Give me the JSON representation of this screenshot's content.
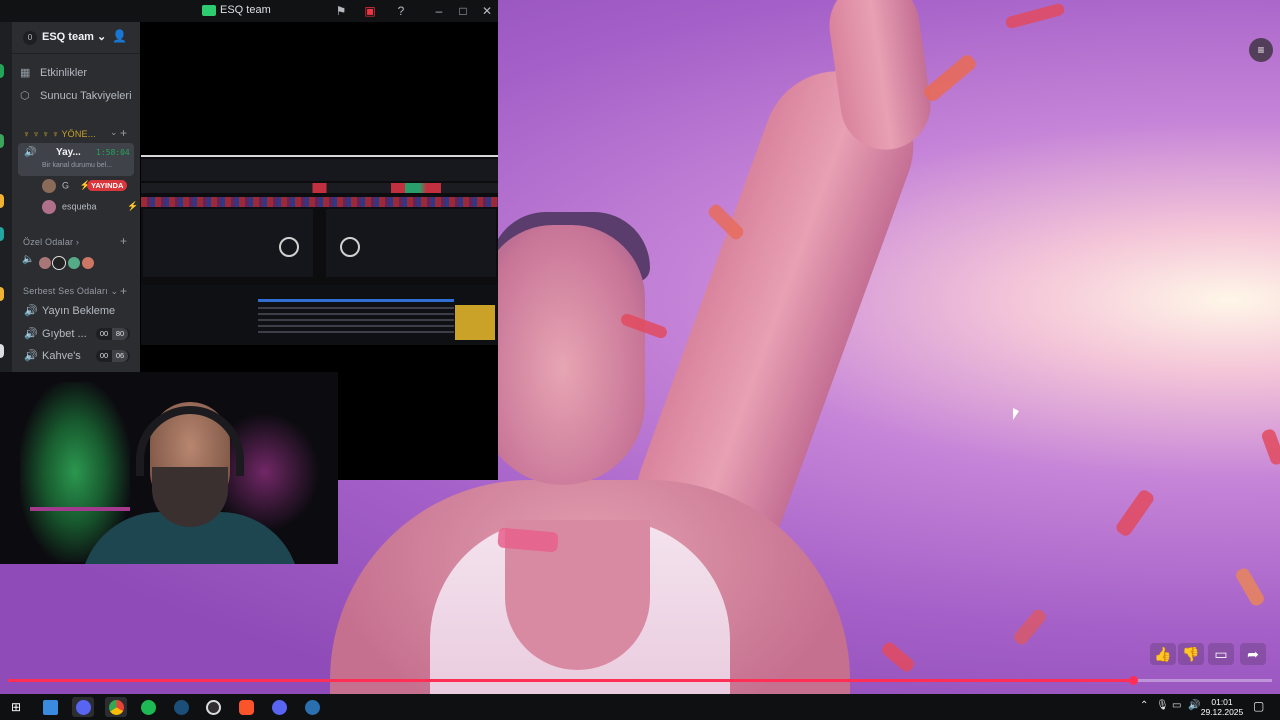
{
  "window": {
    "title": "ESQ team"
  },
  "server": {
    "badge": "0",
    "name": "ESQ team ⌄"
  },
  "nav": [
    {
      "icon": "calendar-icon",
      "label": "Etkinlikler"
    },
    {
      "icon": "boost-icon",
      "label": "Sunucu Takviyeleri"
    }
  ],
  "categories": {
    "admin": "♆ ♆ ♆ ♆ YÖNE...",
    "private": "Özel Odalar ›",
    "free": "Serbest Ses Odaları ⌄"
  },
  "active_voice": {
    "name": "Yay...",
    "timer": "1:58:04",
    "status": "Bir kanal durumu bel..."
  },
  "members": [
    {
      "name": "G",
      "badge": "YAYINDA"
    },
    {
      "name": "esqueba"
    }
  ],
  "channels": [
    {
      "name": "Yayın Bekleme"
    },
    {
      "name": "Gıybet ...",
      "count_a": "00",
      "count_b": "80"
    },
    {
      "name": "Kahve's",
      "count_a": "00",
      "count_b": "06"
    }
  ],
  "colors": {
    "discord_bg": "#2b2d31",
    "live_red": "#da373c",
    "speaking_green": "#23a559",
    "progress": "#ff2e55"
  },
  "video": {
    "progress_pct": 89
  },
  "taskbar": {
    "time": "01:01",
    "date": "29.12.2025",
    "apps": [
      "start-icon",
      "folder-icon",
      "discord-icon",
      "chrome-icon",
      "spotify-icon",
      "steam-icon",
      "obs-icon",
      "brave-icon",
      "app-icon",
      "steam-icon"
    ]
  }
}
